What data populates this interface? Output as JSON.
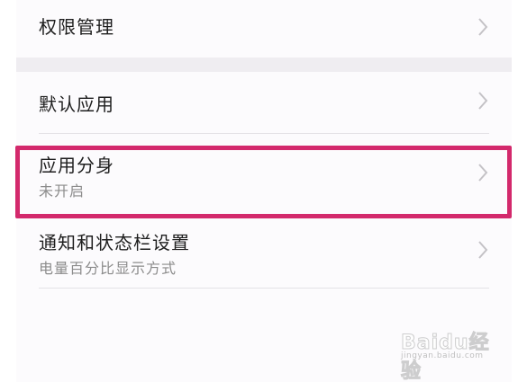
{
  "settings": {
    "items": [
      {
        "title": "权限管理"
      },
      {
        "title": "默认应用"
      },
      {
        "title": "应用分身",
        "subtitle": "未开启"
      },
      {
        "title": "通知和状态栏设置",
        "subtitle": "电量百分比显示方式"
      }
    ]
  },
  "watermark": {
    "brand": "Baidu经验",
    "url": "jingyan.baidu.com"
  },
  "colors": {
    "highlight": "#d3296c",
    "background": "#fcfbfd",
    "section_gap": "#efedf1",
    "title_text": "#1e1e1e",
    "subtitle_text": "#8c8c8c"
  },
  "icons": {
    "chevron": "chevron-right-icon"
  }
}
